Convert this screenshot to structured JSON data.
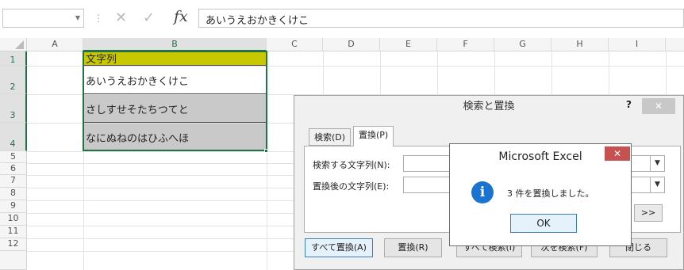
{
  "formula_bar": {
    "name_box_value": "",
    "formula_value": "あいうえおかきくけこ",
    "cancel_glyph": "✕",
    "enter_glyph": "✓",
    "fx_label": "fx"
  },
  "grid": {
    "columns": [
      "A",
      "B",
      "C",
      "D",
      "E",
      "F",
      "G",
      "H",
      "I"
    ],
    "rows": [
      "1",
      "2",
      "3",
      "4",
      "5",
      "6",
      "7",
      "8",
      "9",
      "10",
      "11",
      "12"
    ],
    "selected_column": "B",
    "cells": {
      "b1": "文字列",
      "b2": "あいうえおかきくけこ",
      "b3": "さしすせそたちつてと",
      "b4": "なにぬねのはひふへほ"
    },
    "colors": {
      "header_fill": "#c8c800",
      "replaced_fill": "#c9c9c9",
      "selection": "#217346"
    }
  },
  "find_dialog": {
    "title": "検索と置換",
    "help": "?",
    "close": "✕",
    "tabs": {
      "find": "検索(D)",
      "replace": "置換(P)"
    },
    "find_label": "検索する文字列(N):",
    "replace_label": "置換後の文字列(E):",
    "find_value": "",
    "replace_value": "",
    "options_button": ">>",
    "buttons": {
      "replace_all": "すべて置換(A)",
      "replace": "置換(R)",
      "find_all": "すべて検索(I)",
      "find_next": "次を検索(F)",
      "close": "閉じる"
    }
  },
  "message_box": {
    "title": "Microsoft Excel",
    "close": "✕",
    "icon": "info-icon",
    "message": "3 件を置換しました。",
    "ok": "OK"
  }
}
